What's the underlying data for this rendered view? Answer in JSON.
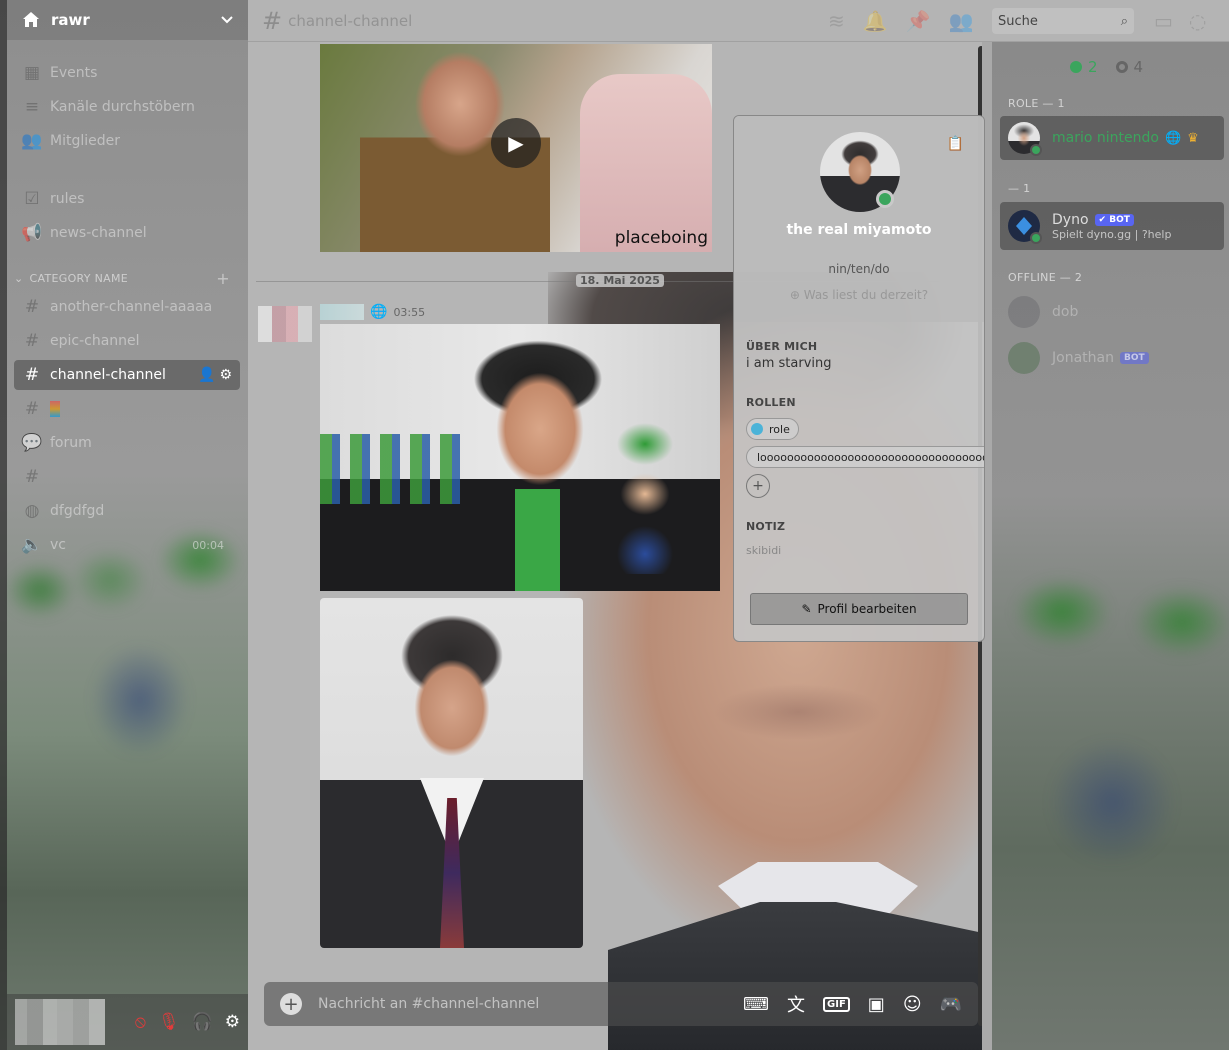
{
  "server": {
    "name": "rawr"
  },
  "sidebar": {
    "items": [
      {
        "label": "Events",
        "icon": "calendar-icon"
      },
      {
        "label": "Kanäle durchstöbern",
        "icon": "browse-icon"
      },
      {
        "label": "Mitglieder",
        "icon": "members-icon"
      },
      {
        "label": "rules",
        "icon": "rules-icon"
      },
      {
        "label": "news-channel",
        "icon": "megaphone-icon"
      }
    ],
    "category": {
      "name": "CATEGORY NAME"
    },
    "channels": [
      {
        "label": "another-channel-aaaaa"
      },
      {
        "label": "epic-channel"
      },
      {
        "label": "channel-channel",
        "active": true
      },
      {
        "label": ""
      },
      {
        "label": "forum"
      },
      {
        "label": ""
      },
      {
        "label": "dfgdfgd"
      },
      {
        "label": "vc",
        "tail": "00:04"
      }
    ]
  },
  "topbar": {
    "channel_name": "channel-channel",
    "search_placeholder": "Suche"
  },
  "chat": {
    "video_caption": "placeboing",
    "date_divider": "18. Mai 2025",
    "message_time": "03:55",
    "composer_placeholder": "Nachricht an #channel-channel",
    "composer_gif": "GIF"
  },
  "profile": {
    "display_name": "the real miyamoto",
    "pronouns": "nin/ten/do",
    "reading_prompt": "Was liest du derzeit?",
    "about_title": "ÜBER MICH",
    "about_text": "i am starving",
    "roles_title": "ROLLEN",
    "roles": [
      {
        "name": "role",
        "color": "#4bb3d8"
      },
      {
        "name": "loooooooooooooooooooooooooooooooooooooooooooooong",
        "color": "#d8d8d8"
      }
    ],
    "note_title": "NOTIZ",
    "note_text": "skibidi",
    "edit_button": "Profil bearbeiten"
  },
  "members": {
    "online_count": "2",
    "offline_count": "4",
    "groups": [
      {
        "title": "ROLE — 1"
      },
      {
        "title": "— 1"
      },
      {
        "title": "OFFLINE — 2"
      }
    ],
    "list": [
      {
        "name": "mario nintendo",
        "color": "#3ba55d"
      },
      {
        "name": "Dyno",
        "bot": "BOT",
        "activity": "Spielt dyno.gg | ?help"
      },
      {
        "name": "dob"
      },
      {
        "name": "Jonathan",
        "bot": "BOT"
      }
    ]
  },
  "colors": {
    "online": "#3ba55d",
    "bot_badge": "#5865f2",
    "mute_red": "#e23b3b"
  }
}
